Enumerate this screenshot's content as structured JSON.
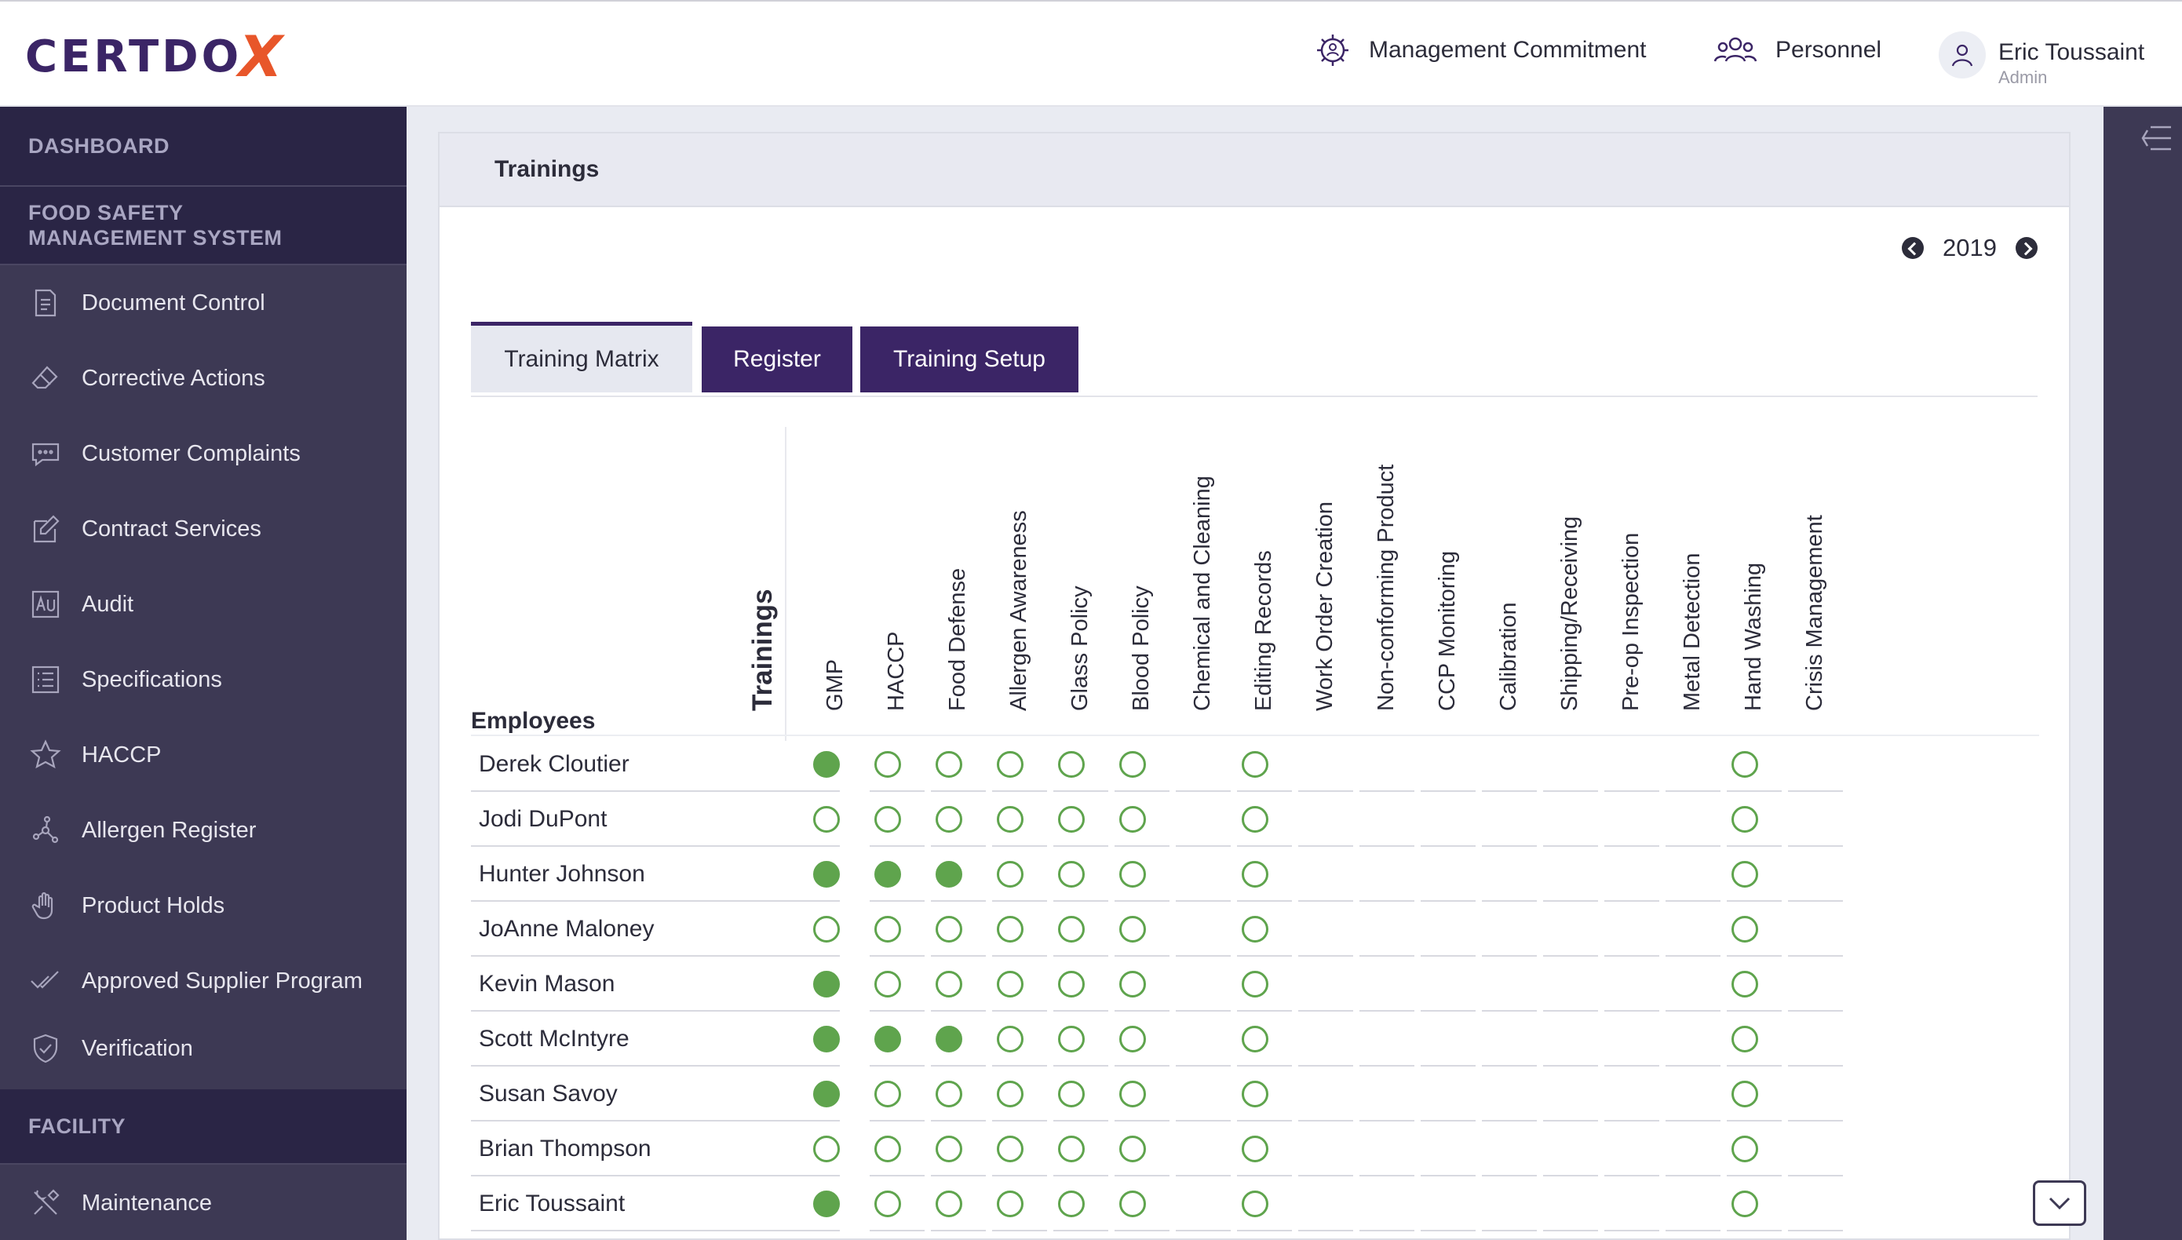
{
  "brand": {
    "logo_text": "CERTDO",
    "logo_x": "X",
    "accent": "#3b2566",
    "logo_accent": "#e8562a"
  },
  "header": {
    "nav": [
      {
        "label": "Management Commitment",
        "icon": "gear-people-icon"
      },
      {
        "label": "Personnel",
        "icon": "people-icon"
      }
    ],
    "user": {
      "name": "Eric Toussaint",
      "role": "Admin",
      "icon": "user-icon"
    }
  },
  "sidebar": {
    "sections": [
      "DASHBOARD",
      "FOOD SAFETY\nMANAGEMENT SYSTEM",
      "FACILITY"
    ],
    "items": [
      {
        "label": "Document Control",
        "icon": "document-icon"
      },
      {
        "label": "Corrective Actions",
        "icon": "eraser-icon"
      },
      {
        "label": "Customer Complaints",
        "icon": "chat-bubble-icon"
      },
      {
        "label": "Contract Services",
        "icon": "edit-icon"
      },
      {
        "label": "Audit",
        "icon": "audit-icon"
      },
      {
        "label": "Specifications",
        "icon": "list-icon"
      },
      {
        "label": "HACCP",
        "icon": "star-icon"
      },
      {
        "label": "Allergen Register",
        "icon": "molecule-icon"
      },
      {
        "label": "Product Holds",
        "icon": "hand-icon"
      },
      {
        "label": "Approved Supplier Program",
        "icon": "double-check-icon"
      },
      {
        "label": "Verification",
        "icon": "shield-check-icon"
      },
      {
        "label": "Maintenance",
        "icon": "tools-icon"
      }
    ]
  },
  "card": {
    "title": "Trainings",
    "year": "2019"
  },
  "tabs": [
    {
      "label": "Training Matrix",
      "active": true
    },
    {
      "label": "Register",
      "active": false
    },
    {
      "label": "Training Setup",
      "active": false
    }
  ],
  "matrix": {
    "employees_label": "Employees",
    "trainings_label": "Trainings",
    "columns": [
      "GMP",
      "HACCP",
      "Food Defense",
      "Allergen Awareness",
      "Glass Policy",
      "Blood Policy",
      "Chemical and Cleaning",
      "Editing Records",
      "Work Order Creation",
      "Non-conforming Product",
      "CCP Monitoring",
      "Calibration",
      "Shipping/Receiving",
      "Pre-op Inspection",
      "Metal Detection",
      "Hand Washing",
      "Crisis Management"
    ],
    "rows": [
      {
        "name": "Derek Cloutier",
        "cells": [
          2,
          1,
          1,
          1,
          1,
          1,
          0,
          1,
          0,
          0,
          0,
          0,
          0,
          0,
          0,
          1,
          0
        ]
      },
      {
        "name": "Jodi DuPont",
        "cells": [
          1,
          1,
          1,
          1,
          1,
          1,
          0,
          1,
          0,
          0,
          0,
          0,
          0,
          0,
          0,
          1,
          0
        ]
      },
      {
        "name": "Hunter Johnson",
        "cells": [
          2,
          2,
          2,
          1,
          1,
          1,
          0,
          1,
          0,
          0,
          0,
          0,
          0,
          0,
          0,
          1,
          0
        ]
      },
      {
        "name": "JoAnne Maloney",
        "cells": [
          1,
          1,
          1,
          1,
          1,
          1,
          0,
          1,
          0,
          0,
          0,
          0,
          0,
          0,
          0,
          1,
          0
        ]
      },
      {
        "name": "Kevin Mason",
        "cells": [
          2,
          1,
          1,
          1,
          1,
          1,
          0,
          1,
          0,
          0,
          0,
          0,
          0,
          0,
          0,
          1,
          0
        ]
      },
      {
        "name": "Scott McIntyre",
        "cells": [
          2,
          2,
          2,
          1,
          1,
          1,
          0,
          1,
          0,
          0,
          0,
          0,
          0,
          0,
          0,
          1,
          0
        ]
      },
      {
        "name": "Susan Savoy",
        "cells": [
          2,
          1,
          1,
          1,
          1,
          1,
          0,
          1,
          0,
          0,
          0,
          0,
          0,
          0,
          0,
          1,
          0
        ]
      },
      {
        "name": "Brian Thompson",
        "cells": [
          1,
          1,
          1,
          1,
          1,
          1,
          0,
          1,
          0,
          0,
          0,
          0,
          0,
          0,
          0,
          1,
          0
        ]
      },
      {
        "name": "Eric Toussaint",
        "cells": [
          2,
          1,
          1,
          1,
          1,
          1,
          0,
          1,
          0,
          0,
          0,
          0,
          0,
          0,
          0,
          1,
          0
        ]
      }
    ],
    "status_colors": {
      "complete": "#5fa44d"
    }
  }
}
